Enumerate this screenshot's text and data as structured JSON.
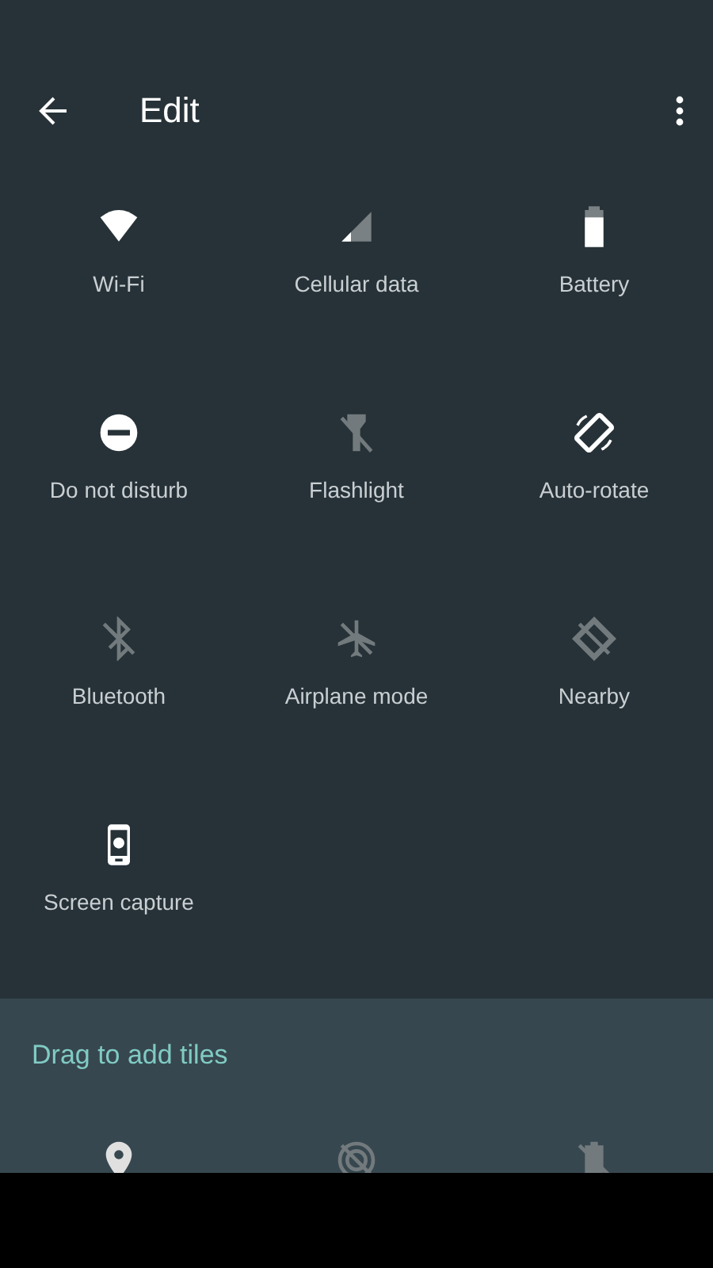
{
  "app_bar": {
    "title": "Edit"
  },
  "tiles": [
    {
      "kind": "wifi",
      "label": "Wi-Fi",
      "on": true
    },
    {
      "kind": "cellular",
      "label": "Cellular data",
      "on": true
    },
    {
      "kind": "battery",
      "label": "Battery",
      "on": true
    },
    {
      "kind": "dnd",
      "label": "Do not disturb",
      "on": true
    },
    {
      "kind": "flashlight",
      "label": "Flashlight",
      "on": false
    },
    {
      "kind": "rotate",
      "label": "Auto-rotate",
      "on": true
    },
    {
      "kind": "bluetooth",
      "label": "Bluetooth",
      "on": false
    },
    {
      "kind": "airplane",
      "label": "Airplane mode",
      "on": false
    },
    {
      "kind": "nearby",
      "label": "Nearby",
      "on": false
    },
    {
      "kind": "screencap",
      "label": "Screen capture",
      "on": true
    }
  ],
  "add_section": {
    "heading": "Drag to add tiles",
    "tiles": [
      {
        "kind": "location",
        "on": true
      },
      {
        "kind": "hotspot",
        "on": false
      },
      {
        "kind": "saver",
        "on": false
      }
    ]
  }
}
